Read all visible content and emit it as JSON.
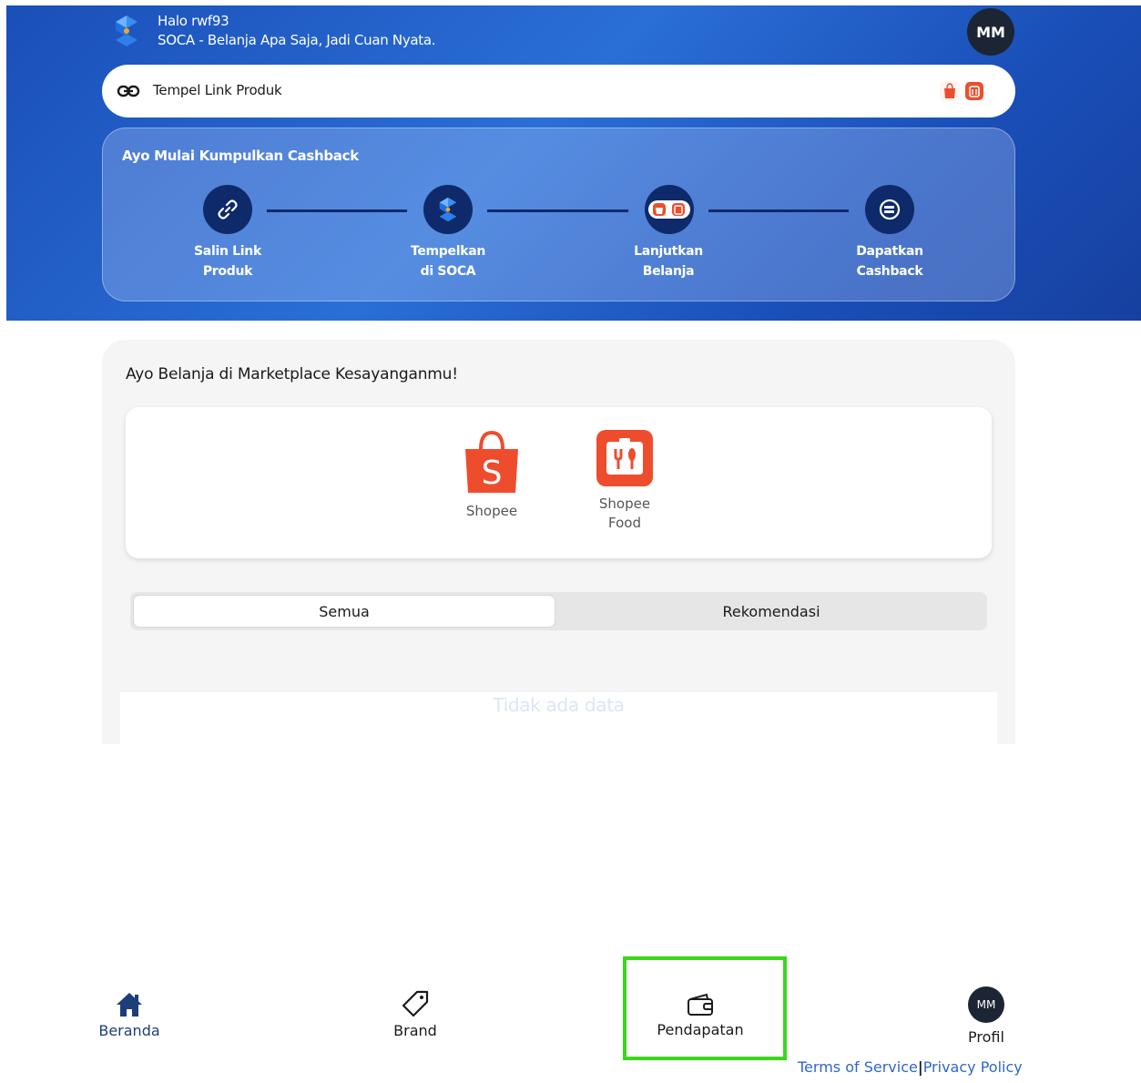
{
  "header": {
    "greeting": "Halo rwf93",
    "tagline": "SOCA - Belanja Apa Saja, Jadi Cuan Nyata.",
    "avatar_initials": "MM",
    "brand_color": "#1a4fb8"
  },
  "link_input": {
    "placeholder": "Tempel Link Produk"
  },
  "steps": {
    "title": "Ayo Mulai Kumpulkan Cashback",
    "items": [
      {
        "line1": "Salin Link",
        "line2": "Produk",
        "icon": "link-icon"
      },
      {
        "line1": "Tempelkan",
        "line2": "di SOCA",
        "icon": "soca-logo-icon"
      },
      {
        "line1": "Lanjutkan",
        "line2": "Belanja",
        "icon": "shop-icons"
      },
      {
        "line1": "Dapatkan",
        "line2": "Cashback",
        "icon": "cashback-icon"
      }
    ]
  },
  "marketplace": {
    "heading": "Ayo Belanja di Marketplace Kesayanganmu!",
    "items": [
      {
        "label": "Shopee",
        "icon": "shopee-bag-icon",
        "color": "#ee4d2d"
      },
      {
        "label_line1": "Shopee",
        "label_line2": "Food",
        "icon": "shopee-food-icon",
        "color": "#ee4d2d"
      }
    ]
  },
  "tabs": {
    "all": "Semua",
    "recommended": "Rekomendasi",
    "selected": "Semua"
  },
  "empty_state": "Tidak ada data",
  "bottom_nav": {
    "home": "Beranda",
    "brand": "Brand",
    "income": "Pendapatan",
    "profile": "Profil",
    "profile_initials": "MM"
  },
  "footer": {
    "terms": "Terms of Service",
    "separator": "|",
    "privacy": "Privacy Policy"
  }
}
